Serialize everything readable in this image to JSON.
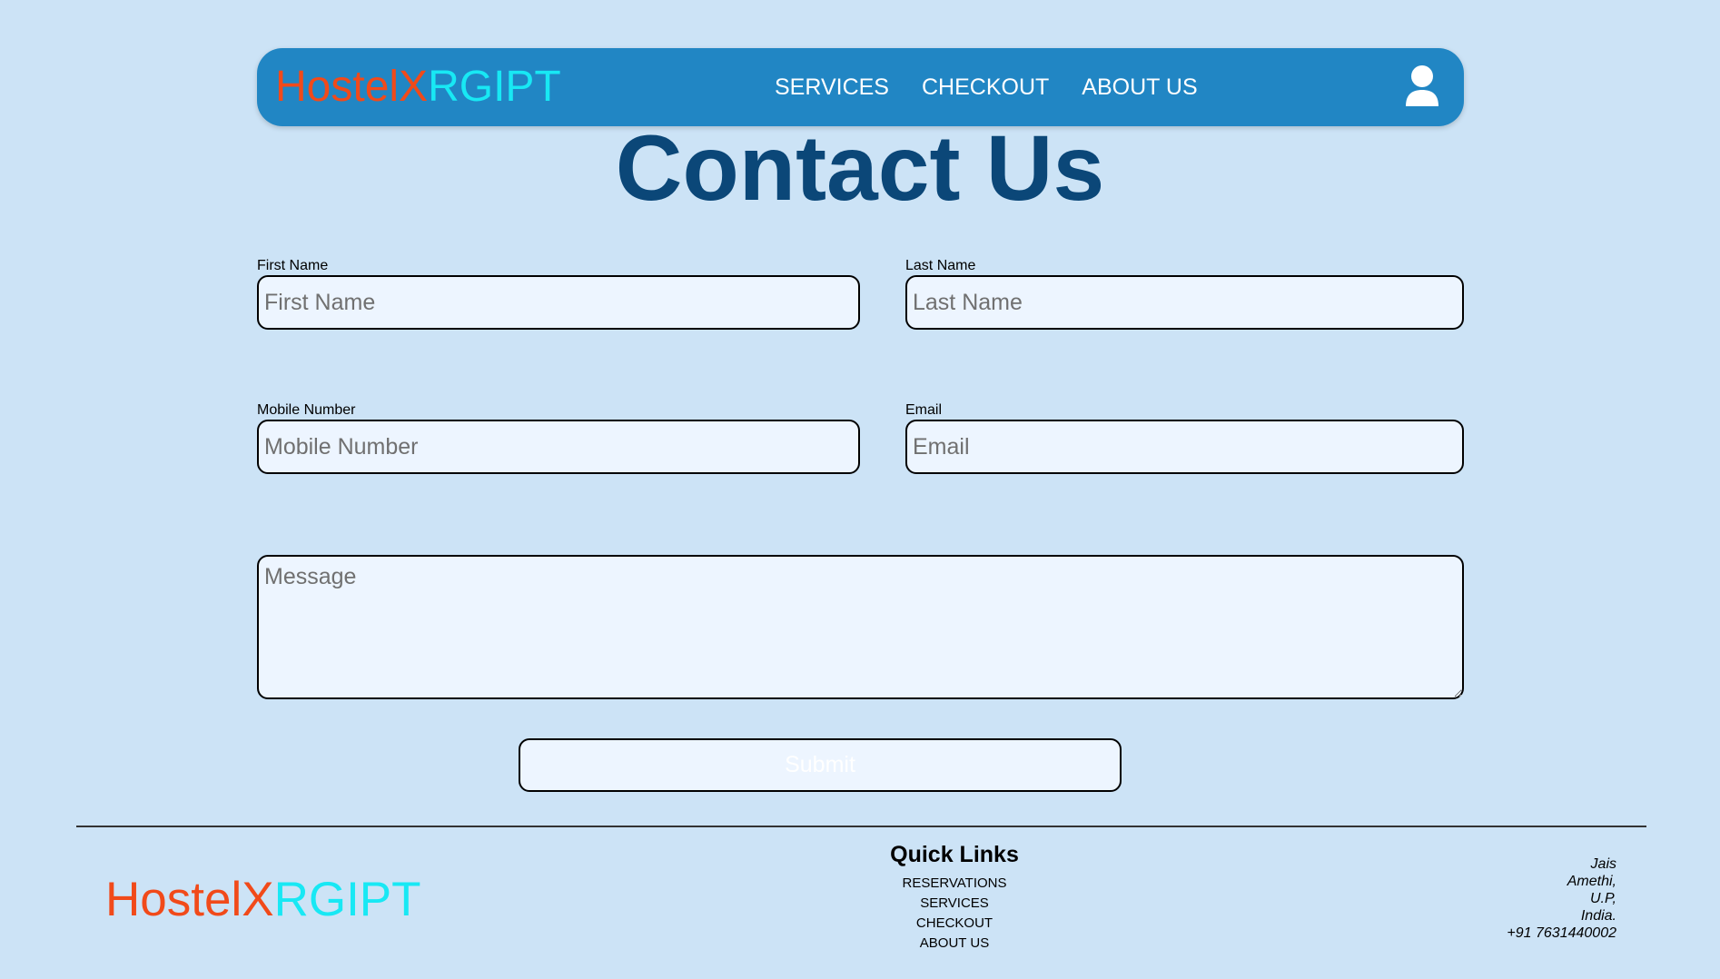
{
  "navbar": {
    "brand_part1": "HostelX",
    "brand_part2": "RGIPT",
    "links": [
      "SERVICES",
      "CHECKOUT",
      "ABOUT US"
    ],
    "user_icon": "user-profile-icon"
  },
  "page": {
    "title": "Contact Us"
  },
  "form": {
    "first_name": {
      "label": "First Name",
      "placeholder": "First Name",
      "value": ""
    },
    "last_name": {
      "label": "Last Name",
      "placeholder": "Last Name",
      "value": ""
    },
    "mobile": {
      "label": "Mobile Number",
      "placeholder": "Mobile Number",
      "value": ""
    },
    "email": {
      "label": "Email",
      "placeholder": "Email",
      "value": ""
    },
    "message": {
      "placeholder": "Message",
      "value": ""
    },
    "submit_label": "Submit"
  },
  "footer": {
    "brand_part1": "HostelX",
    "brand_part2": "RGIPT",
    "quick_links_title": "Quick Links",
    "quick_links": [
      "RESERVATIONS",
      "SERVICES",
      "CHECKOUT",
      "ABOUT US"
    ],
    "address_lines": [
      "Jais",
      "Amethi,",
      "U.P,",
      "India.",
      "+91 7631440002"
    ]
  },
  "colors": {
    "background": "#cce3f6",
    "navbar": "#2186c4",
    "brand_primary": "#f14a1a",
    "brand_secondary": "#18e8f4",
    "title": "#0b4778",
    "input_background": "#edf5ff"
  }
}
